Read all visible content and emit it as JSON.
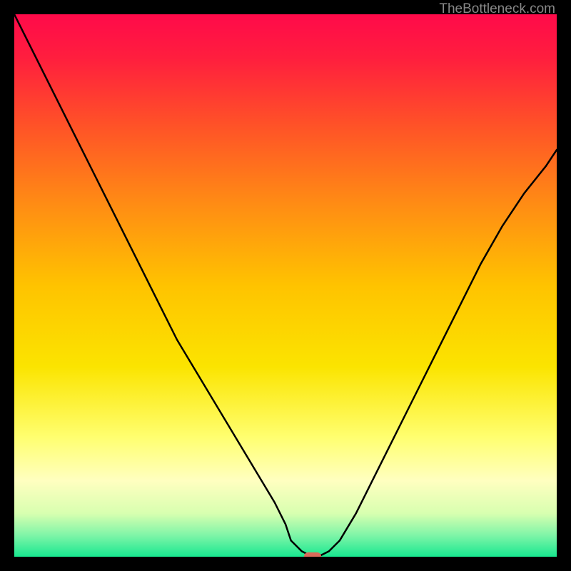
{
  "watermark": "TheBottleneck.com",
  "chart_data": {
    "type": "line",
    "title": "",
    "xlabel": "",
    "ylabel": "",
    "xlim": [
      0,
      100
    ],
    "ylim": [
      0,
      100
    ],
    "background_gradient": {
      "stops": [
        {
          "offset": 0.0,
          "color": "#ff0a4a"
        },
        {
          "offset": 0.08,
          "color": "#ff1e3e"
        },
        {
          "offset": 0.2,
          "color": "#ff5028"
        },
        {
          "offset": 0.35,
          "color": "#ff8c14"
        },
        {
          "offset": 0.5,
          "color": "#ffc300"
        },
        {
          "offset": 0.65,
          "color": "#fbe400"
        },
        {
          "offset": 0.78,
          "color": "#ffff70"
        },
        {
          "offset": 0.86,
          "color": "#ffffc0"
        },
        {
          "offset": 0.92,
          "color": "#d8ffb0"
        },
        {
          "offset": 0.96,
          "color": "#80f5a8"
        },
        {
          "offset": 1.0,
          "color": "#18e890"
        }
      ]
    },
    "series": [
      {
        "name": "bottleneck-curve",
        "color": "#000000",
        "stroke_width": 2.5,
        "x": [
          0,
          3,
          6,
          9,
          12,
          15,
          18,
          21,
          24,
          27,
          30,
          33,
          36,
          39,
          42,
          45,
          48,
          50,
          51,
          53,
          55,
          56,
          58,
          60,
          63,
          66,
          70,
          74,
          78,
          82,
          86,
          90,
          94,
          98,
          100
        ],
        "y": [
          100,
          94,
          88,
          82,
          76,
          70,
          64,
          58,
          52,
          46,
          40,
          35,
          30,
          25,
          20,
          15,
          10,
          6,
          3,
          1,
          0,
          0,
          1,
          3,
          8,
          14,
          22,
          30,
          38,
          46,
          54,
          61,
          67,
          72,
          75
        ]
      }
    ],
    "marker": {
      "name": "optimal-point",
      "x": 55,
      "y": 0,
      "color": "#d96a5a",
      "width": 3.2,
      "height": 1.6
    }
  }
}
